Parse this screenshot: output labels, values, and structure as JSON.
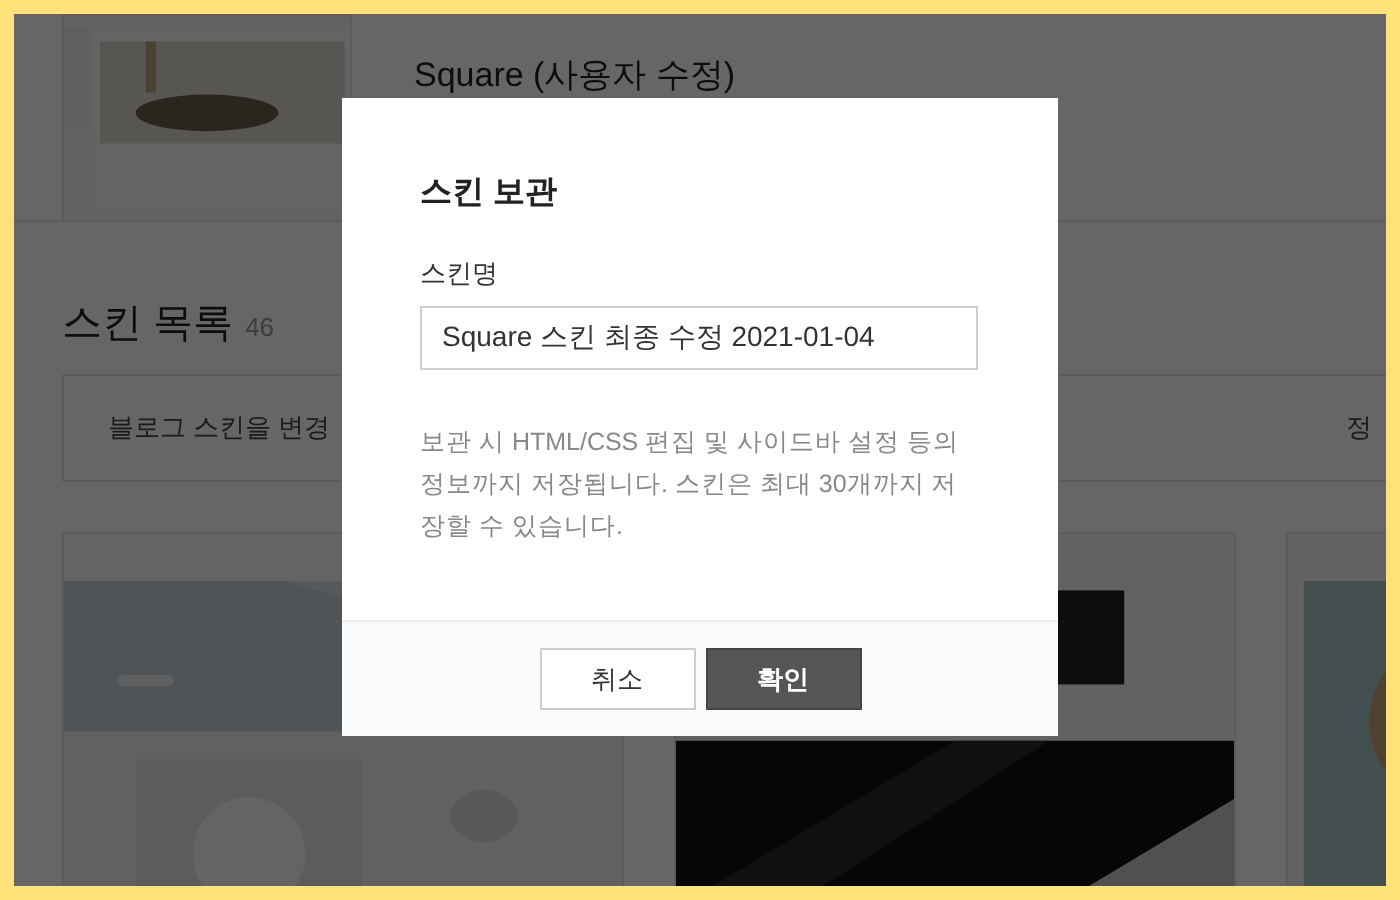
{
  "current_skin": {
    "name": "Square (사용자 수정)"
  },
  "skin_list": {
    "title": "스킨 목록",
    "count": "46",
    "notice_left": "블로그 스킨을 변경",
    "notice_right": "정"
  },
  "dialog": {
    "title": "스킨 보관",
    "field_label": "스킨명",
    "field_value": "Square 스킨 최종 수정 2021-01-04",
    "description": "보관 시 HTML/CSS 편집 및 사이드바 설정 등의 정보까지 저장됩니다. 스킨은 최대 30개까지 저장할 수 있습니다.",
    "buttons": [
      {
        "label": "취소",
        "kind": "secondary"
      },
      {
        "label": "확인",
        "kind": "primary"
      }
    ]
  }
}
